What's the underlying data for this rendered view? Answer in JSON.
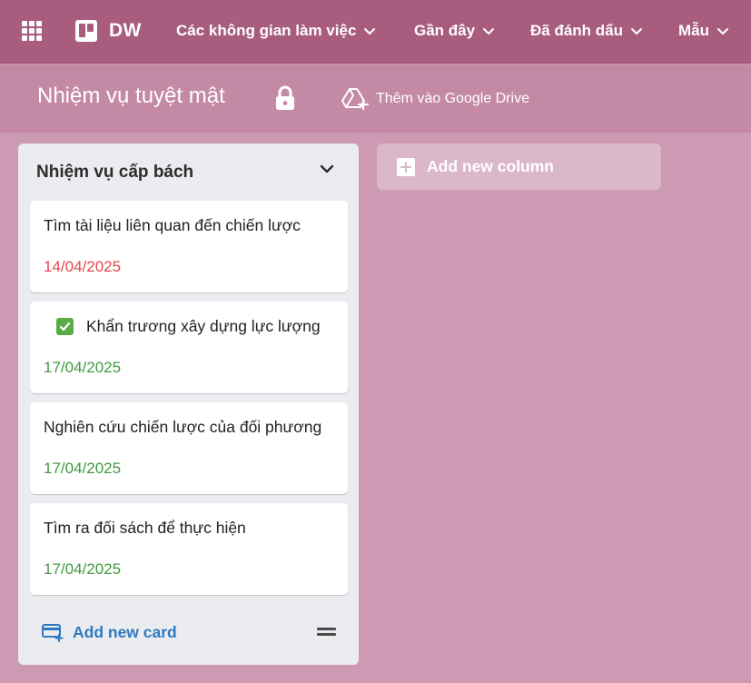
{
  "header": {
    "brand": "DW",
    "nav": [
      {
        "label": "Các không gian làm việc"
      },
      {
        "label": "Gần đây"
      },
      {
        "label": "Đã đánh dấu"
      },
      {
        "label": "Mẫu"
      }
    ]
  },
  "board": {
    "title": "Nhiệm vụ tuyệt mật",
    "drive_label": "Thêm vào Google Drive"
  },
  "column": {
    "title": "Nhiệm vụ cấp bách",
    "cards": [
      {
        "title": "Tìm tài liệu liên quan đến chiến lược",
        "date": "14/04/2025",
        "checked": false
      },
      {
        "title": "Khẩn trương xây dựng lực lượng",
        "date": "17/04/2025",
        "checked": true
      },
      {
        "title": "Nghiên cứu chiến lược của đối phương",
        "date": "17/04/2025",
        "checked": false
      },
      {
        "title": "Tìm ra đối sách để thực hiện",
        "date": "17/04/2025",
        "checked": false
      }
    ],
    "add_card_label": "Add new card"
  },
  "add_column_label": "Add new column",
  "colors": {
    "topbar": "#a85c7e",
    "boardbar": "#c48aa5",
    "background": "#cc9ab2",
    "date_overdue": "#e5484d",
    "date_ok": "#3f9a3f",
    "accent_blue": "#2d7ac0"
  }
}
